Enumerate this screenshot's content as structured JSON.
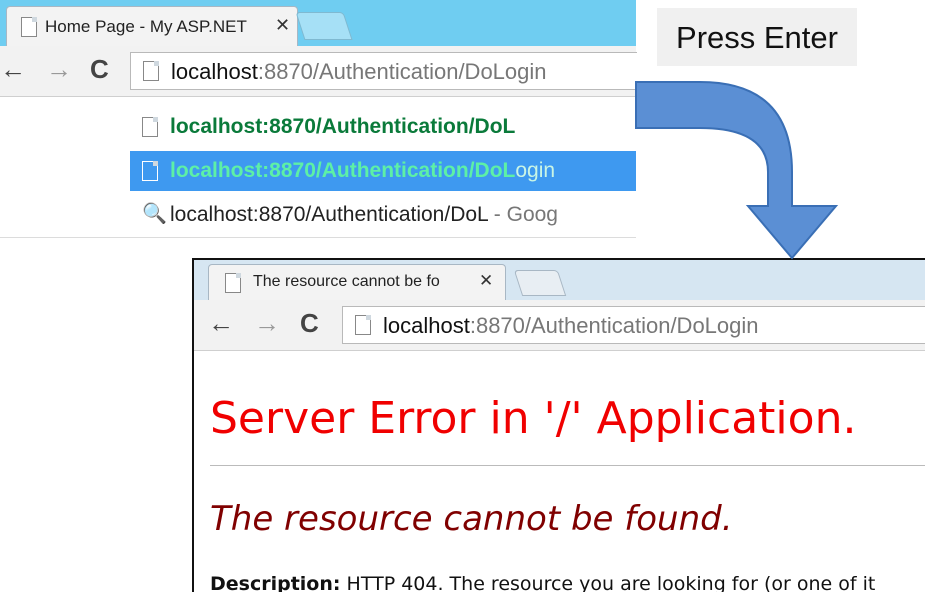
{
  "top_browser": {
    "tab_title": "Home Page - My ASP.NET",
    "close_glyph": "✕",
    "back_glyph": "←",
    "forward_glyph": "→",
    "reload_glyph": "C",
    "address_host": "localhost",
    "address_path": ":8870/Authentication/DoLogin",
    "suggestions": [
      {
        "bold": "localhost:8870/Authentication/DoL",
        "rest": ""
      },
      {
        "bold": "localhost:8870/Authentication/DoL",
        "rest": "ogin"
      },
      {
        "text": "localhost:8870/Authentication/DoL",
        "suffix": " - Goog"
      }
    ],
    "search_glyph": "🔍"
  },
  "callout": {
    "label": "Press Enter",
    "arrow_color": "#5b8fd4"
  },
  "bottom_browser": {
    "tab_title": "The resource cannot be fo",
    "close_glyph": "✕",
    "back_glyph": "←",
    "forward_glyph": "→",
    "reload_glyph": "C",
    "address_host": "localhost",
    "address_path": ":8870/Authentication/DoLogin",
    "error_title": "Server Error in '/' Application.",
    "error_subtitle": "The resource cannot be found.",
    "description_label": "Description:",
    "description_text": " HTTP 404. The resource you are looking for (or one of it"
  },
  "colors": {
    "tabstrip_active": "#6fcdf1",
    "tabstrip_inactive": "#d6e6f2",
    "suggestion_highlight": "#3e99f0",
    "error_red": "#f00000",
    "error_maroon": "#800000",
    "url_green": "#0a7a3a"
  }
}
